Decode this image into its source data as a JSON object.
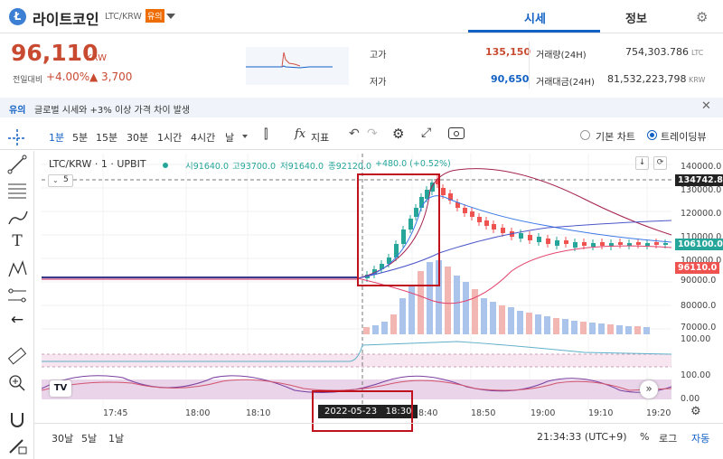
{
  "header": {
    "coin_name": "라이트코인",
    "pair": "LTC/KRW",
    "warning_badge": "유의",
    "tabs": [
      "시세",
      "정보"
    ],
    "active_tab": 0
  },
  "price": {
    "current": "96,110",
    "currency": "KRW",
    "change_label": "전일대비",
    "change_pct": "+4.00%",
    "change_abs": "▲ 3,700"
  },
  "stats": {
    "high_label": "고가",
    "high": "135,150",
    "low_label": "저가",
    "low": "90,650",
    "volume_label": "거래량(24H)",
    "volume": "754,303.786",
    "volume_unit": "LTC",
    "amount_label": "거래대금(24H)",
    "amount": "81,532,223,798",
    "amount_unit": "KRW"
  },
  "notice": {
    "badge": "유의",
    "text": "글로벌 시세와 +3% 이상 가격 차이 발생"
  },
  "toolbar": {
    "intervals": [
      "1분",
      "5분",
      "15분",
      "30분",
      "1시간",
      "4시간",
      "날"
    ],
    "active_interval": 0,
    "fx": "fx",
    "indicators": "지표",
    "chart_modes": [
      "기본 차트",
      "트레이딩뷰"
    ],
    "active_mode": 1
  },
  "legend": {
    "symbol": "LTC/KRW · 1 · UPBIT",
    "open": "시91640.0",
    "high": "고93700.0",
    "low": "저91640.0",
    "close": "종92120.0",
    "change": "+480.0 (+0.52%)",
    "collapse": "5"
  },
  "price_axis": [
    "140000.0",
    "130000.0",
    "120000.0",
    "110000.0",
    "100000.0",
    "90000.0",
    "80000.0",
    "70000.0"
  ],
  "price_tags": {
    "crosshair": "134742.8",
    "last": "106100.0",
    "ref": "96110.0"
  },
  "osc_axis": [
    "100.00",
    "100.00",
    "0.00"
  ],
  "time_axis": [
    "17:45",
    "18:00",
    "18:10",
    "18:40",
    "18:50",
    "19:00",
    "19:10",
    "19:20"
  ],
  "crosshair_time": "2022-05-23   18:30",
  "footer": {
    "ranges": [
      "30날",
      "5날",
      "1날"
    ],
    "clock": "21:34:33 (UTC+9)",
    "pct": "%",
    "log": "로그",
    "auto": "자동"
  },
  "logo": "TV",
  "colors": {
    "accent": "#1261c4",
    "up": "#d24f45",
    "down": "#1261c4",
    "candle_up": "#26a69a",
    "candle_down": "#ef5350"
  }
}
